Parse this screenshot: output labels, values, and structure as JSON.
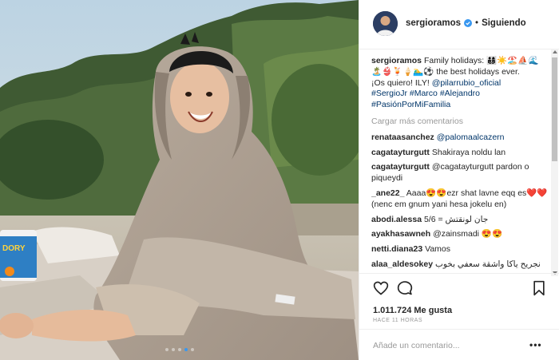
{
  "post": {
    "username": "sergioramos",
    "follow_status": "Siguiendo",
    "separator": "•",
    "caption_user": "sergioramos",
    "caption_text": "Family holidays: 👨‍👩‍👦‍👦☀️🏖️⛵🌊🏝️👙🍹🍦🏊‍♂️⚽ the best holidays ever.",
    "caption_text2": "¡Os quiero! ILY!",
    "caption_tag1": "@pilarrubio_oficial",
    "caption_hashtags": [
      "#SergioJr",
      "#Marco",
      "#Alejandro",
      "#PasiónPorMiFamilia"
    ],
    "load_more": "Cargar más comentarios",
    "comments": [
      {
        "user": "renataasanchez",
        "text": "@palomaalcazern",
        "is_tag": true
      },
      {
        "user": "cagatayturgutt",
        "text": "Shakiraya noldu lan",
        "is_tag": false
      },
      {
        "user": "cagatayturgutt",
        "text": "@cagatayturgutt pardon o piqueydi",
        "is_tag": false
      },
      {
        "user": "_ane22_",
        "text": "Aaaa😍😍ezr shat lavne eqq es❤️❤️ (nenc em gnum yani hesa jokelu en)",
        "is_tag": false
      },
      {
        "user": "abodi.alessa",
        "text": "5/6 = جان لونقتش",
        "is_tag": false
      },
      {
        "user": "ayakhasawneh",
        "text": "@zainsmadi 😍😍",
        "is_tag": false
      },
      {
        "user": "netti.diana23",
        "text": "Vamos",
        "is_tag": false
      },
      {
        "user": "alaa_aldesokey",
        "text": "نجريح ياكا واشقة سعفي بخوب",
        "is_tag": false
      }
    ],
    "likes": "1.011.724 Me gusta",
    "timestamp": "HACE 11 HORAS",
    "add_comment_placeholder": "Añade un comentario...",
    "more_options": "•••",
    "carousel": {
      "count": 5,
      "active_index": 3
    },
    "bucket_label": "DORY"
  },
  "colors": {
    "accent": "#3897f0",
    "link": "#003569",
    "verified": "#3897f0",
    "muted": "#999999"
  },
  "icons": [
    "verified-badge-icon",
    "heart-icon",
    "comment-icon",
    "bookmark-icon",
    "more-options-icon"
  ]
}
